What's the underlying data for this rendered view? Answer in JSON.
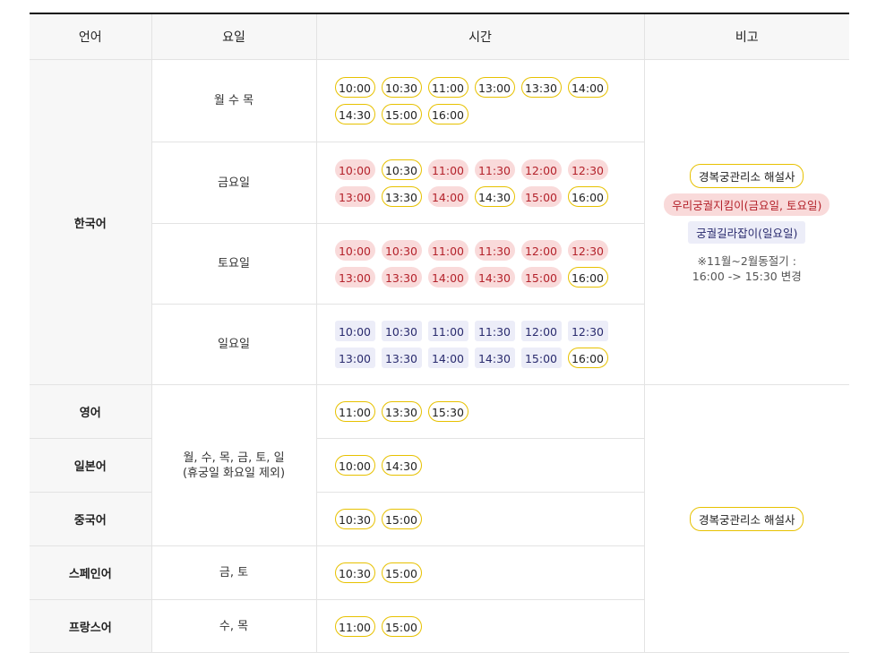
{
  "headers": [
    "언어",
    "요일",
    "시간",
    "비고"
  ],
  "korean": {
    "language": "한국어",
    "rows": [
      {
        "days": "월 수 목",
        "times": [
          {
            "t": "10:00",
            "s": "y"
          },
          {
            "t": "10:30",
            "s": "y"
          },
          {
            "t": "11:00",
            "s": "y"
          },
          {
            "t": "13:00",
            "s": "y"
          },
          {
            "t": "13:30",
            "s": "y"
          },
          {
            "t": "14:00",
            "s": "y"
          },
          {
            "t": "14:30",
            "s": "y"
          },
          {
            "t": "15:00",
            "s": "y"
          },
          {
            "t": "16:00",
            "s": "y"
          }
        ]
      },
      {
        "days": "금요일",
        "times": [
          {
            "t": "10:00",
            "s": "r"
          },
          {
            "t": "10:30",
            "s": "y"
          },
          {
            "t": "11:00",
            "s": "r"
          },
          {
            "t": "11:30",
            "s": "r"
          },
          {
            "t": "12:00",
            "s": "r"
          },
          {
            "t": "12:30",
            "s": "r"
          },
          {
            "t": "13:00",
            "s": "r"
          },
          {
            "t": "13:30",
            "s": "y"
          },
          {
            "t": "14:00",
            "s": "r"
          },
          {
            "t": "14:30",
            "s": "y"
          },
          {
            "t": "15:00",
            "s": "r"
          },
          {
            "t": "16:00",
            "s": "y"
          }
        ]
      },
      {
        "days": "토요일",
        "times": [
          {
            "t": "10:00",
            "s": "r"
          },
          {
            "t": "10:30",
            "s": "r"
          },
          {
            "t": "11:00",
            "s": "r"
          },
          {
            "t": "11:30",
            "s": "r"
          },
          {
            "t": "12:00",
            "s": "r"
          },
          {
            "t": "12:30",
            "s": "r"
          },
          {
            "t": "13:00",
            "s": "r"
          },
          {
            "t": "13:30",
            "s": "r"
          },
          {
            "t": "14:00",
            "s": "r"
          },
          {
            "t": "14:30",
            "s": "r"
          },
          {
            "t": "15:00",
            "s": "r"
          },
          {
            "t": "16:00",
            "s": "y"
          }
        ]
      },
      {
        "days": "일요일",
        "times": [
          {
            "t": "10:00",
            "s": "b"
          },
          {
            "t": "10:30",
            "s": "b"
          },
          {
            "t": "11:00",
            "s": "b"
          },
          {
            "t": "11:30",
            "s": "b"
          },
          {
            "t": "12:00",
            "s": "b"
          },
          {
            "t": "12:30",
            "s": "b"
          },
          {
            "t": "13:00",
            "s": "b"
          },
          {
            "t": "13:30",
            "s": "b"
          },
          {
            "t": "14:00",
            "s": "b"
          },
          {
            "t": "14:30",
            "s": "b"
          },
          {
            "t": "15:00",
            "s": "b"
          },
          {
            "t": "16:00",
            "s": "y"
          }
        ]
      }
    ],
    "notes": {
      "guide_official": "경복궁관리소 해설사",
      "guide_keeper": "우리궁궐지킴이(금요일, 토요일)",
      "guide_path": "궁궐길라잡이(일요일)",
      "memo_line1": "※11월~2월동절기 :",
      "memo_line2": "16:00 -> 15:30 변경"
    }
  },
  "foreign": {
    "shared_days_line1": "월, 수, 목, 금, 토, 일",
    "shared_days_line2": "(휴궁일 화요일 제외)",
    "note": "경복궁관리소 해설사",
    "rows": [
      {
        "language": "영어",
        "days": null,
        "times": [
          {
            "t": "11:00",
            "s": "y"
          },
          {
            "t": "13:30",
            "s": "y"
          },
          {
            "t": "15:30",
            "s": "y"
          }
        ]
      },
      {
        "language": "일본어",
        "days": null,
        "times": [
          {
            "t": "10:00",
            "s": "y"
          },
          {
            "t": "14:30",
            "s": "y"
          }
        ]
      },
      {
        "language": "중국어",
        "days": null,
        "times": [
          {
            "t": "10:30",
            "s": "y"
          },
          {
            "t": "15:00",
            "s": "y"
          }
        ]
      },
      {
        "language": "스페인어",
        "days": "금, 토",
        "times": [
          {
            "t": "10:30",
            "s": "y"
          },
          {
            "t": "15:00",
            "s": "y"
          }
        ]
      },
      {
        "language": "프랑스어",
        "days": "수, 목",
        "times": [
          {
            "t": "11:00",
            "s": "y"
          },
          {
            "t": "15:00",
            "s": "y"
          }
        ]
      }
    ]
  },
  "colors": {
    "accent_yellow": "#e7c100",
    "red_bg": "#f9dada",
    "red_text": "#b4222b",
    "blue_bg": "#ecedf8",
    "blue_text": "#2a2b6e"
  }
}
